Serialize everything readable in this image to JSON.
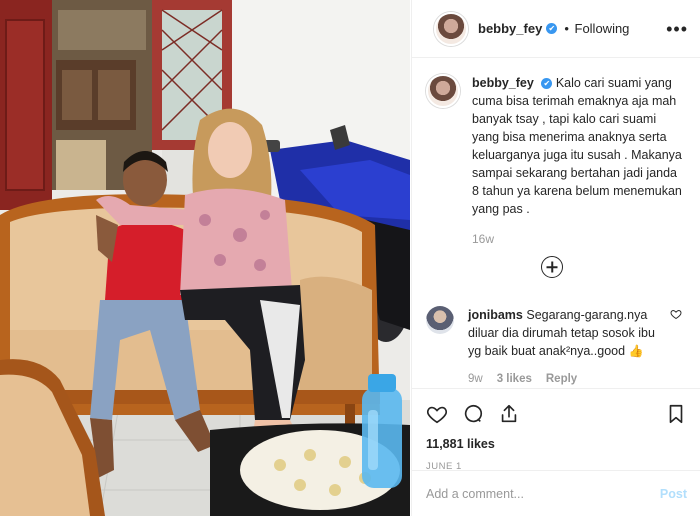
{
  "post": {
    "username": "bebby_fey",
    "verified_badge": "✔",
    "separator": "•",
    "follow_status": "Following",
    "more_icon": "ellipsis-icon"
  },
  "caption": {
    "username": "bebby_fey",
    "text": "Kalo cari suami yang cuma bisa terimah emaknya aja mah banyak tsay , tapi kalo cari suami yang bisa menerima anaknya serta keluarganya juga itu susah . Makanya sampai sekarang bertahan jadi janda 8 tahun ya karena belum menemukan yang pas .",
    "time": "16w"
  },
  "comments": [
    {
      "username": "jonibams",
      "text": "Segarang-garang.nya diluar dia dirumah tetap sosok ibu yg baik buat anak²nya..good",
      "emoji": "👍",
      "time": "9w",
      "likes": "3 likes",
      "reply": "Reply"
    }
  ],
  "actions": {
    "like_count": "11,881 likes",
    "date": "JUNE 1"
  },
  "composer": {
    "placeholder": "Add a comment...",
    "post_label": "Post"
  },
  "colors": {
    "accent": "#3897f0",
    "post_disabled": "#b2dffc",
    "muted": "#999999"
  }
}
